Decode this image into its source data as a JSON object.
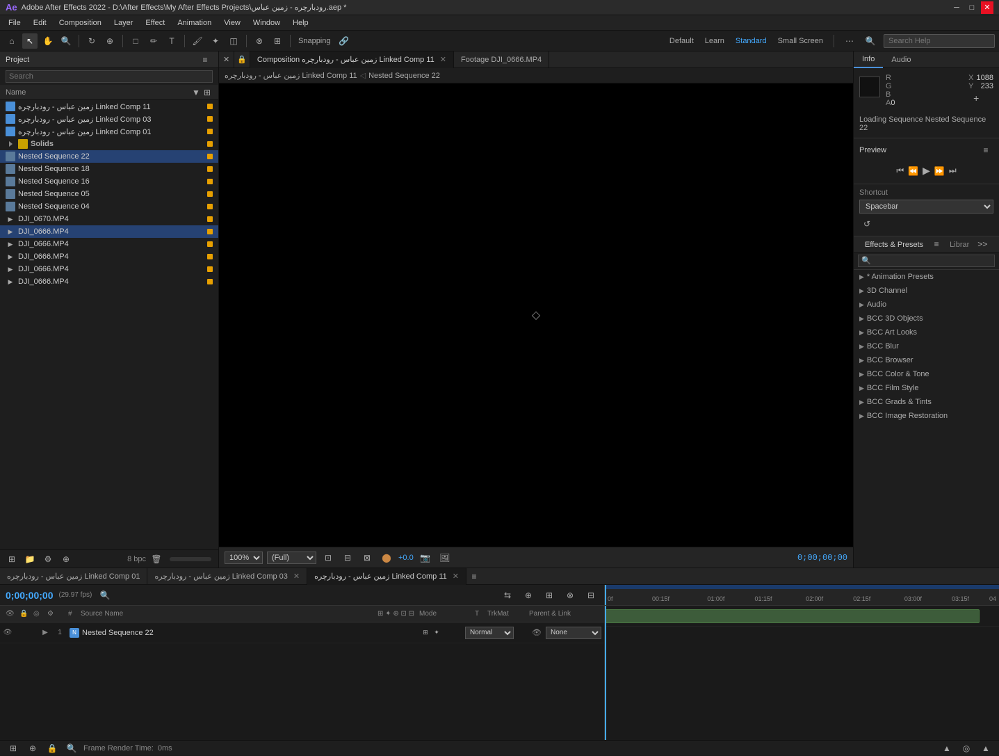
{
  "titlebar": {
    "title": "Adobe After Effects 2022 - D:\\After Effects\\My After Effects Projects\\رودبارچره - زمین عباس.aep *",
    "close_btn": "✕",
    "max_btn": "□",
    "min_btn": "─"
  },
  "menubar": {
    "items": [
      "File",
      "Edit",
      "Composition",
      "Layer",
      "Effect",
      "Animation",
      "View",
      "Window",
      "Help"
    ]
  },
  "toolbar": {
    "snapping_label": "Snapping",
    "layout_items": [
      "Default",
      "Learn",
      "Standard",
      "Small Screen"
    ],
    "active_layout": "Standard",
    "search_placeholder": "Search Help"
  },
  "project": {
    "header_label": "Project",
    "search_placeholder": "Search",
    "col_name": "Name",
    "items": [
      {
        "id": 1,
        "name": "زمین عباس - رودبارچره Linked Comp 11",
        "type": "comp",
        "indent": 0,
        "selected": false,
        "marker": "yellow"
      },
      {
        "id": 2,
        "name": "زمین عباس - رودبارچره Linked Comp 03",
        "type": "comp",
        "indent": 0,
        "selected": false,
        "marker": "yellow"
      },
      {
        "id": 3,
        "name": "زمین عباس - رودبارچره Linked Comp 01",
        "type": "comp",
        "indent": 0,
        "selected": false,
        "marker": "yellow"
      },
      {
        "id": 4,
        "name": "Solids",
        "type": "folder",
        "indent": 0,
        "selected": false,
        "marker": "yellow"
      },
      {
        "id": 5,
        "name": "Nested Sequence 22",
        "type": "nested",
        "indent": 0,
        "selected": true,
        "marker": "yellow"
      },
      {
        "id": 6,
        "name": "Nested Sequence 18",
        "type": "nested",
        "indent": 0,
        "selected": false,
        "marker": "yellow"
      },
      {
        "id": 7,
        "name": "Nested Sequence 16",
        "type": "nested",
        "indent": 0,
        "selected": false,
        "marker": "yellow"
      },
      {
        "id": 8,
        "name": "Nested Sequence 05",
        "type": "nested",
        "indent": 0,
        "selected": false,
        "marker": "yellow"
      },
      {
        "id": 9,
        "name": "Nested Sequence 04",
        "type": "nested",
        "indent": 0,
        "selected": false,
        "marker": "yellow"
      },
      {
        "id": 10,
        "name": "DJI_0670.MP4",
        "type": "footage",
        "indent": 0,
        "selected": false,
        "marker": "yellow"
      },
      {
        "id": 11,
        "name": "DJI_0666.MP4",
        "type": "footage",
        "indent": 0,
        "selected": true,
        "marker": "yellow",
        "highlighted": true
      },
      {
        "id": 12,
        "name": "DJI_0666.MP4",
        "type": "footage",
        "indent": 0,
        "selected": false,
        "marker": "yellow"
      },
      {
        "id": 13,
        "name": "DJI_0666.MP4",
        "type": "footage",
        "indent": 0,
        "selected": false,
        "marker": "yellow"
      },
      {
        "id": 14,
        "name": "DJI_0666.MP4",
        "type": "footage",
        "indent": 0,
        "selected": false,
        "marker": "yellow"
      },
      {
        "id": 15,
        "name": "DJI_0666.MP4",
        "type": "footage",
        "indent": 0,
        "selected": false,
        "marker": "yellow"
      }
    ]
  },
  "viewer": {
    "tabs": [
      {
        "label": "Composition زمین عباس - رودبارچره Linked Comp 11",
        "active": true,
        "closable": true
      },
      {
        "label": "Footage DJI_0666.MP4",
        "active": false,
        "closable": false
      }
    ],
    "breadcrumb": [
      "زمین عباس - رودبارچره Linked Comp 11",
      "Nested Sequence 22"
    ],
    "zoom": "100%",
    "quality": "(Full)",
    "timecode": "0;00;00;00"
  },
  "info_panel": {
    "tabs": [
      "Info",
      "Audio"
    ],
    "active_tab": "Info",
    "r_label": "R",
    "g_label": "G",
    "b_label": "B",
    "a_label": "A",
    "r_val": "",
    "g_val": "",
    "b_val": "",
    "a_val": "0",
    "x_label": "X",
    "y_label": "Y",
    "x_val": "1088",
    "y_val": "233",
    "loading_text": "Loading Sequence Nested Sequence 22"
  },
  "preview": {
    "header": "Preview",
    "shortcut_label": "Shortcut",
    "shortcut_option": "Spacebar",
    "btn_first": "⏮",
    "btn_prev": "⏪",
    "btn_play": "▶",
    "btn_next": "⏩",
    "btn_last": "⏭"
  },
  "effects": {
    "tabs": [
      "Effects & Presets",
      "Librar"
    ],
    "active_tab": "Effects & Presets",
    "search_placeholder": "🔍",
    "items": [
      {
        "label": "* Animation Presets",
        "expanded": false
      },
      {
        "label": "3D Channel",
        "expanded": false
      },
      {
        "label": "Audio",
        "expanded": false
      },
      {
        "label": "BCC 3D Objects",
        "expanded": false
      },
      {
        "label": "BCC Art Looks",
        "expanded": false
      },
      {
        "label": "BCC Blur",
        "expanded": false
      },
      {
        "label": "BCC Browser",
        "expanded": false
      },
      {
        "label": "BCC Color & Tone",
        "expanded": false
      },
      {
        "label": "BCC Film Style",
        "expanded": false
      },
      {
        "label": "BCC Grads & Tints",
        "expanded": false
      },
      {
        "label": "BCC Image Restoration",
        "expanded": false
      }
    ]
  },
  "timeline": {
    "tabs": [
      {
        "label": "زمین عباس - رودبارچره Linked Comp 01",
        "active": false,
        "closable": false
      },
      {
        "label": "زمین عباس - رودبارچره Linked Comp 03",
        "active": false,
        "closable": true
      },
      {
        "label": "زمین عباس - رودبارچره Linked Comp 11",
        "active": true,
        "closable": true
      }
    ],
    "timecode": "0;00;00;00",
    "fps": "(29.97 fps)",
    "cols": [
      "#",
      "Source Name",
      "Mode",
      "T",
      "TrkMat",
      "Parent & Link"
    ],
    "layers": [
      {
        "num": "1",
        "name": "Nested Sequence 22",
        "mode": "Normal",
        "parent": "None",
        "type": "nested"
      }
    ],
    "ruler_marks": [
      "0f",
      "00:15f",
      "01:00f",
      "01:15f",
      "02:00f",
      "02:15f",
      "03:00f",
      "03:15f",
      "04"
    ],
    "track_bar_start": 0,
    "track_bar_width": 95
  },
  "footer": {
    "render_time_label": "Frame Render Time:",
    "render_time_val": "0ms"
  }
}
